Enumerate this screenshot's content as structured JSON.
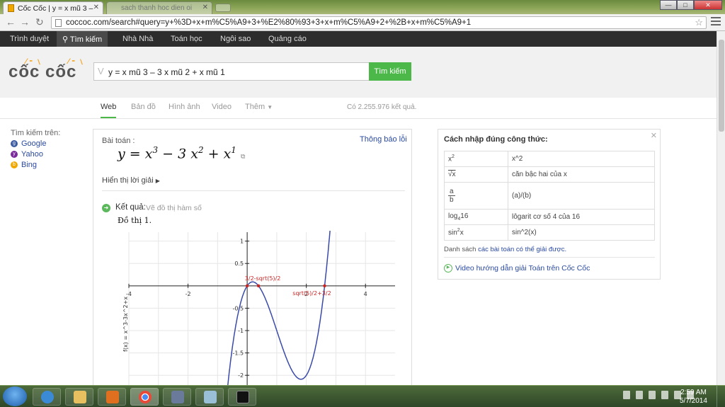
{
  "browser": {
    "tab_active_title": "Cốc Cốc | y = x mũ 3 – 3 x mũ 2 + x mũ 1",
    "tab2_title": "sach thanh hoc dien oi",
    "url": "coccoc.com/search#query=y+%3D+x+m%C5%A9+3+%E2%80%93+3+x+m%C5%A9+2+%2B+x+m%C5%A9+1"
  },
  "topnav": [
    "Trình duyệt",
    "Tìm kiếm",
    "Nhà Nhà",
    "Toán học",
    "Ngôi sao",
    "Quảng cáo"
  ],
  "search": {
    "logo": "cốc cốc",
    "query": "y = x mũ 3 – 3 x mũ 2 + x mũ 1",
    "button": "Tìm kiếm"
  },
  "tabs": [
    "Web",
    "Bản đồ",
    "Hình ảnh",
    "Video",
    "Thêm"
  ],
  "result_count": "Có 2.255.976 kết quả.",
  "left": {
    "heading": "Tìm kiếm trên:",
    "engines": [
      {
        "name": "Google",
        "color": "#3b5ba0"
      },
      {
        "name": "Yahoo",
        "color": "#7a2a9a"
      },
      {
        "name": "Bing",
        "color": "#f0a800"
      }
    ]
  },
  "problem": {
    "label": "Bài toán :",
    "report": "Thông báo lỗi",
    "formula_lhs": "y",
    "show_solution": "Hiển thị lời giải",
    "result_label": "Kết quả:",
    "result_desc": "Vẽ đồ thị hàm số",
    "graph_label": "Đồ thị 1."
  },
  "chart_data": {
    "type": "line",
    "function": "x^3 - 3x^2 + x",
    "ylabel": "f(x) = x^3-3x^2+x",
    "x_ticks": [
      "-4",
      "-2",
      "2",
      "4"
    ],
    "y_ticks": [
      "1",
      "0.5",
      "-0.5",
      "-1",
      "-1.5",
      "-2"
    ],
    "x_tick_values": [
      -4,
      -2,
      2,
      4
    ],
    "y_tick_values": [
      1,
      0.5,
      -0.5,
      -1,
      -1.5,
      -2
    ],
    "annotations": [
      "3/2-sqrt(5)/2",
      "sqrt(5)/2+3/2"
    ],
    "roots": [
      0,
      0.382,
      2.618
    ],
    "xlim": [
      -4,
      5
    ],
    "ylim": [
      -2.25,
      1.2
    ],
    "curve_color": "#3a4aa8",
    "point_color": "#cc2222"
  },
  "hint": {
    "title": "Cách nhập đúng công thức:",
    "rows": [
      {
        "expr": "x",
        "sup": "2",
        "desc": "x^2"
      },
      {
        "expr": "√x",
        "desc": "căn bậc hai của x"
      },
      {
        "num": "a",
        "den": "b",
        "desc": "(a)/(b)"
      },
      {
        "expr": "log",
        "sub": "4",
        "tail": "16",
        "desc": "lôgarit cơ số 4 của 16"
      },
      {
        "expr": "sin",
        "sup": "2",
        "tail": "x",
        "desc": "sin^2(x)"
      }
    ],
    "note_prefix": "Danh sách",
    "note_link": "các bài toán có thể giải được.",
    "video": "Video hướng dẫn giải Toán trên Cốc Cốc"
  },
  "taskbar": {
    "time": "2:59 AM",
    "date": "5/7/2014"
  }
}
